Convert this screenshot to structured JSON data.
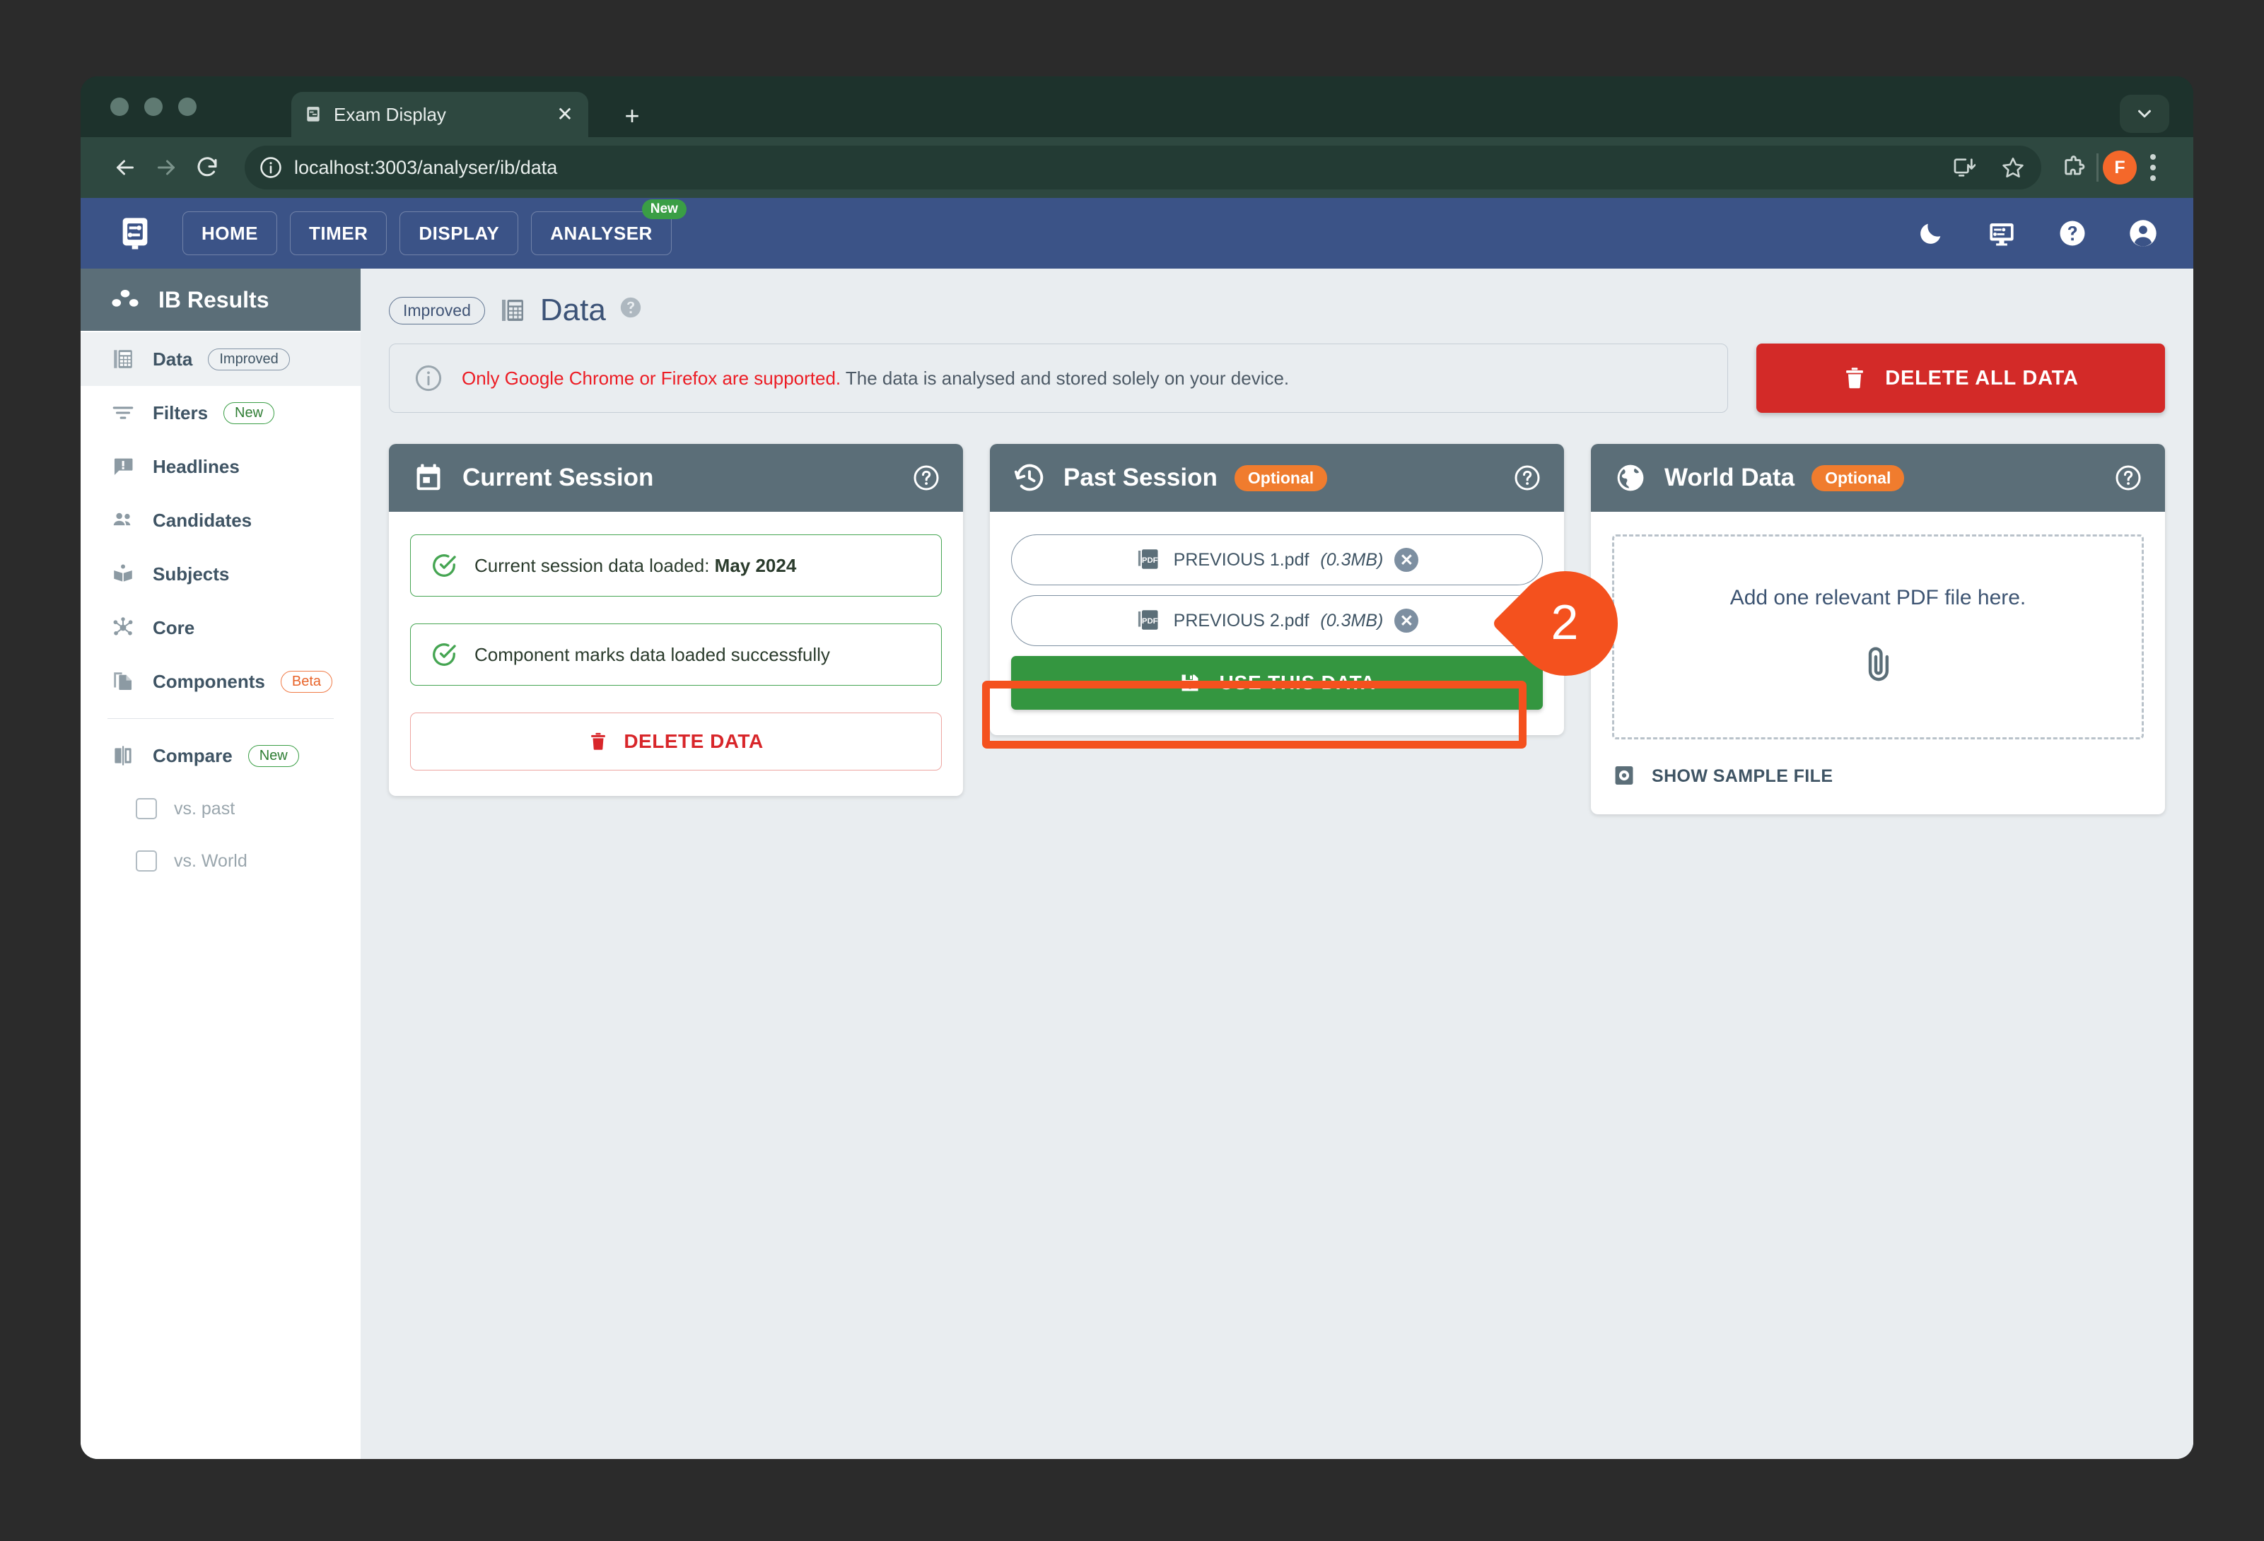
{
  "browser": {
    "tab": {
      "title": "Exam Display",
      "favicon_icon": "sliders-icon",
      "close_icon": "close-icon"
    },
    "new_tab_icon": "plus-icon",
    "window_menu_icon": "chevron-down-icon",
    "back_icon": "arrow-left-icon",
    "forward_icon": "arrow-right-icon",
    "reload_icon": "reload-icon",
    "url": "localhost:3003/analyser/ib/data",
    "site_info_icon": "info-circle-icon",
    "install_icon": "install-app-icon",
    "bookmark_icon": "star-icon",
    "extensions_icon": "puzzle-piece-icon",
    "profile_initial": "F",
    "menu_icon": "kebab-menu-icon"
  },
  "appnav": {
    "logo_icon": "exam-display-logo-icon",
    "links": [
      {
        "label": "HOME",
        "badge": ""
      },
      {
        "label": "TIMER",
        "badge": ""
      },
      {
        "label": "DISPLAY",
        "badge": ""
      },
      {
        "label": "ANALYSER",
        "badge": "New"
      }
    ],
    "right_icons": [
      "moon-icon",
      "display-icon",
      "help-circle-icon",
      "account-circle-icon"
    ],
    "accent_bg": "#3b5387",
    "badge_green": "#3a9e45"
  },
  "sidebar": {
    "header": {
      "title": "IB Results",
      "icon": "results-dots-icon"
    },
    "items": [
      {
        "label": "Data",
        "icon": "table-icon",
        "badge": "Improved",
        "badge_type": "improved",
        "active": true
      },
      {
        "label": "Filters",
        "icon": "filter-icon",
        "badge": "New",
        "badge_type": "new",
        "active": false
      },
      {
        "label": "Headlines",
        "icon": "announcement-icon",
        "badge": "",
        "badge_type": "",
        "active": false
      },
      {
        "label": "Candidates",
        "icon": "people-icon",
        "badge": "",
        "badge_type": "",
        "active": false
      },
      {
        "label": "Subjects",
        "icon": "book-icon",
        "badge": "",
        "badge_type": "",
        "active": false
      },
      {
        "label": "Core",
        "icon": "hub-icon",
        "badge": "",
        "badge_type": "",
        "active": false
      },
      {
        "label": "Components",
        "icon": "documents-icon",
        "badge": "Beta",
        "badge_type": "beta",
        "active": false
      }
    ],
    "compare": {
      "label": "Compare",
      "icon": "compare-icon",
      "badge": "New",
      "badge_type": "new"
    },
    "compare_options": [
      {
        "label": "vs. past",
        "checked": false
      },
      {
        "label": "vs. World",
        "checked": false
      }
    ]
  },
  "page": {
    "pill": "Improved",
    "icon": "table-icon",
    "title": "Data",
    "help_icon": "help-circle-icon"
  },
  "alert": {
    "icon": "info-circle-icon",
    "warning": "Only Google Chrome or Firefox are supported.",
    "rest": " The data is analysed and stored solely on your device."
  },
  "delete_all": {
    "label": "DELETE ALL DATA",
    "icon": "trash-icon",
    "color": "#d32a28"
  },
  "cards": {
    "current_session": {
      "title": "Current Session",
      "icon": "calendar-icon",
      "help_icon": "help-circle-icon",
      "status": [
        {
          "prefix": "Current session data loaded: ",
          "strong": "May 2024",
          "icon": "check-circle-icon"
        },
        {
          "prefix": "Component marks data loaded successfully",
          "strong": "",
          "icon": "check-circle-icon"
        }
      ],
      "delete_button": {
        "label": "DELETE DATA",
        "icon": "trash-icon"
      }
    },
    "past_session": {
      "title": "Past Session",
      "icon": "history-icon",
      "badge": "Optional",
      "help_icon": "help-circle-icon",
      "files": [
        {
          "name": "PREVIOUS 1.pdf",
          "size": "(0.3MB)",
          "icon": "pdf-file-icon",
          "remove_icon": "close-circle-icon"
        },
        {
          "name": "PREVIOUS 2.pdf",
          "size": "(0.3MB)",
          "icon": "pdf-file-icon",
          "remove_icon": "close-circle-icon"
        }
      ],
      "use_button": {
        "label": "USE THIS DATA",
        "icon": "save-icon",
        "color": "#349640"
      }
    },
    "world_data": {
      "title": "World Data",
      "icon": "globe-icon",
      "badge": "Optional",
      "help_icon": "help-circle-icon",
      "dropzone_text": "Add one relevant PDF file here.",
      "dropzone_icon": "paperclip-icon",
      "sample_link": {
        "label": "SHOW SAMPLE FILE",
        "icon": "preview-icon"
      }
    }
  },
  "annotation": {
    "step_number": "2",
    "highlight_color": "#f4511e"
  }
}
